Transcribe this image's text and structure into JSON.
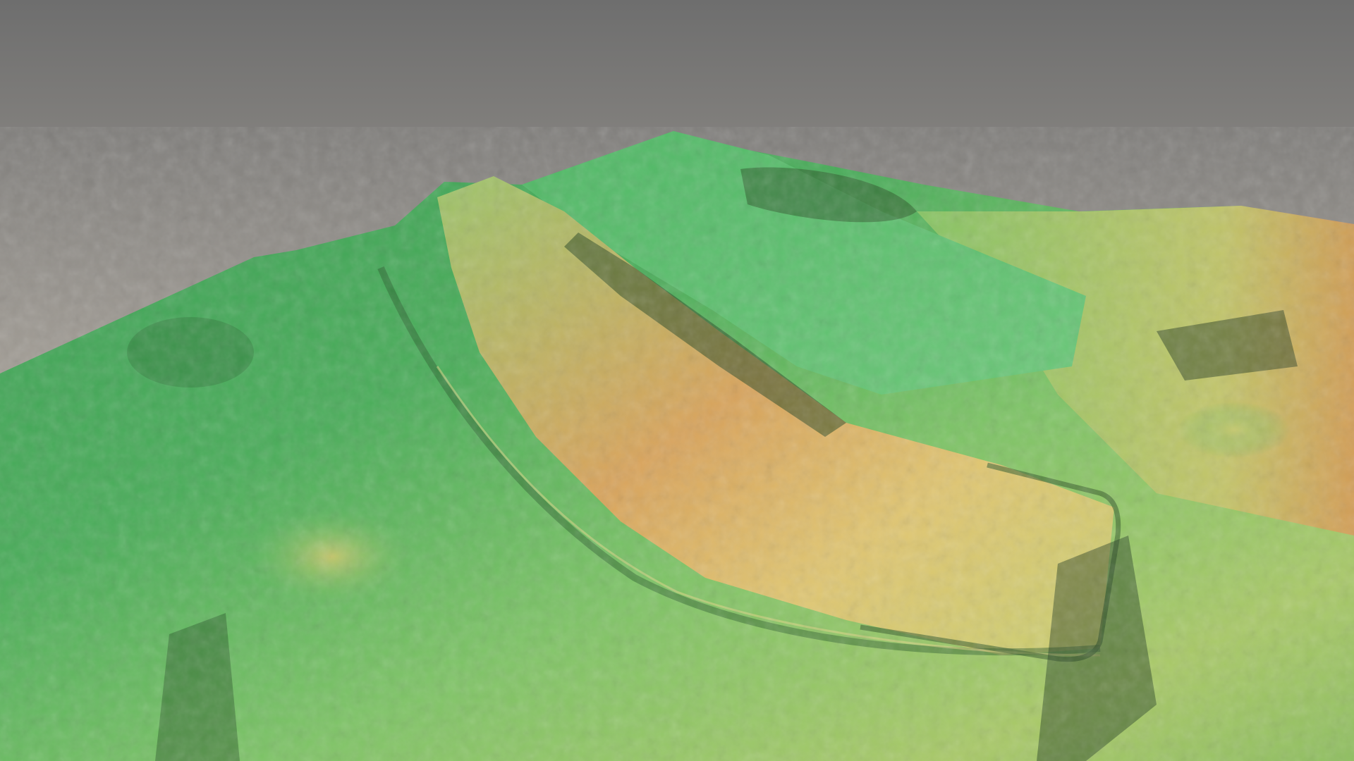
{
  "scene": {
    "subject": "3d-terrain-relief",
    "colors": {
      "sky_top": "#707070",
      "sky_bottom": "#b0aaa0",
      "lowland_green": "#3fa859",
      "mid_green": "#6cbf63",
      "plateau_green": "#5dbf6b",
      "highland_yellow": "#d8c36a",
      "ridge_orange": "#d99a55",
      "shadow": "#1f3a1f"
    }
  }
}
